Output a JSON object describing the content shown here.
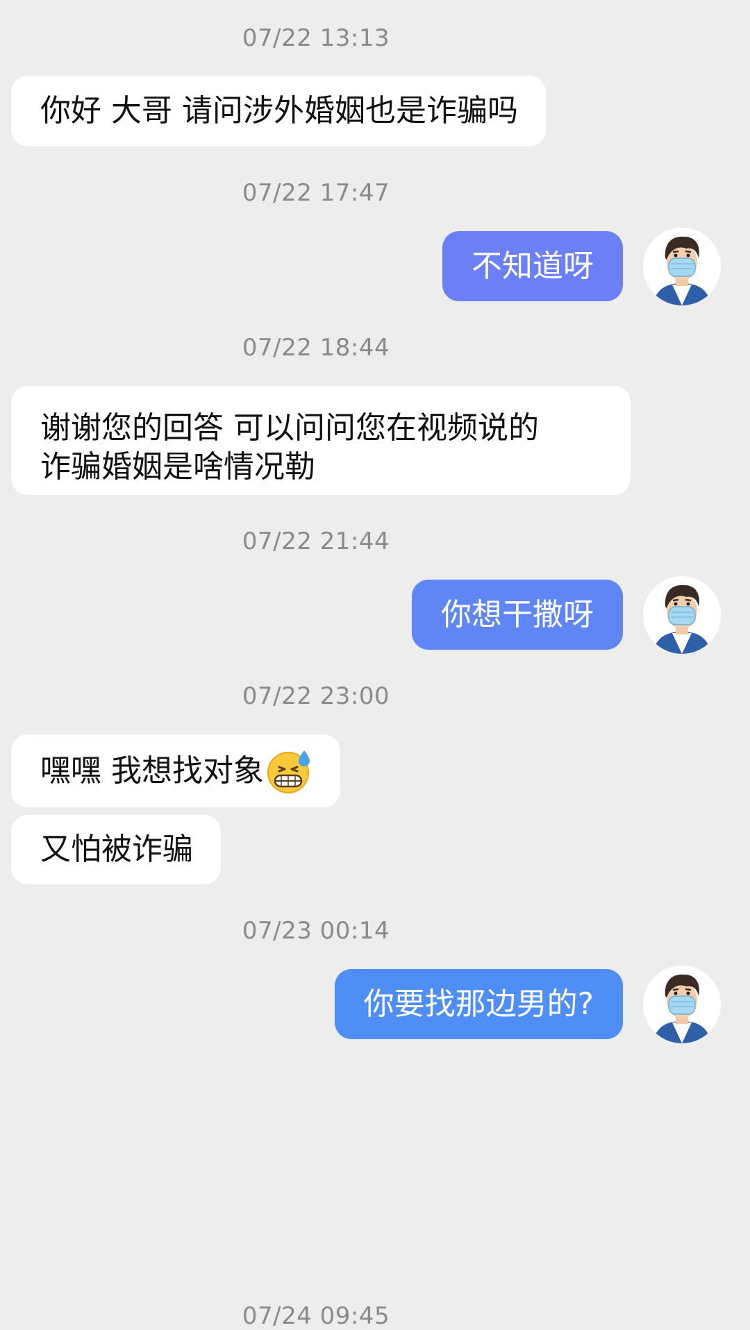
{
  "conversation": {
    "timestamps": [
      "07/22 13:13",
      "07/22 17:47",
      "07/22 18:44",
      "07/22 21:44",
      "07/22 23:00",
      "07/23 00:14",
      "07/24 09:45"
    ],
    "messages": [
      {
        "from": "other",
        "text": "你好 大哥 请问涉外婚姻也是诈骗吗"
      },
      {
        "from": "me",
        "text": "不知道呀"
      },
      {
        "from": "other",
        "lines": [
          "谢谢您的回答 可以问问您在视频说的",
          "诈骗婚姻是啥情况勒"
        ]
      },
      {
        "from": "me",
        "text": "你想干撒呀"
      },
      {
        "from": "other",
        "text": "嘿嘿 我想找对象",
        "emoji": "grimacing-sweat-emoji"
      },
      {
        "from": "other",
        "text": "又怕被诈骗"
      },
      {
        "from": "me",
        "text": "你要找那边男的?"
      }
    ]
  },
  "colors": {
    "background": "#ededed",
    "incoming_bubble": "#ffffff",
    "outgoing_bubble_1": "#6b7ff6",
    "outgoing_bubble_2": "#5f86f4",
    "outgoing_bubble_3": "#4f8ff5",
    "timestamp_text": "#8a8a8a"
  },
  "icons": {
    "avatar": "masked-man-avatar-icon",
    "emoji": "grimacing-sweat-emoji"
  }
}
